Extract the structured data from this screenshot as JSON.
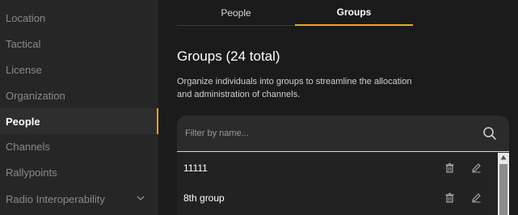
{
  "sidebar": {
    "items": [
      {
        "label": "Location"
      },
      {
        "label": "Tactical"
      },
      {
        "label": "License"
      },
      {
        "label": "Organization"
      },
      {
        "label": "People",
        "active": true
      },
      {
        "label": "Channels"
      },
      {
        "label": "Rallypoints"
      },
      {
        "label": "Radio Interoperability",
        "expandable": true
      }
    ]
  },
  "tabs": [
    {
      "label": "People"
    },
    {
      "label": "Groups",
      "active": true
    }
  ],
  "main": {
    "title": "Groups (24 total)",
    "description": "Organize individuals into groups to streamline the allocation and administration of channels.",
    "filter_placeholder": "Filter by name...",
    "rows": [
      {
        "name": "11111"
      },
      {
        "name": "8th group"
      }
    ]
  },
  "colors": {
    "accent": "#f0a81c",
    "sidebar_bg": "#262626",
    "main_bg": "#1b1b1b"
  }
}
